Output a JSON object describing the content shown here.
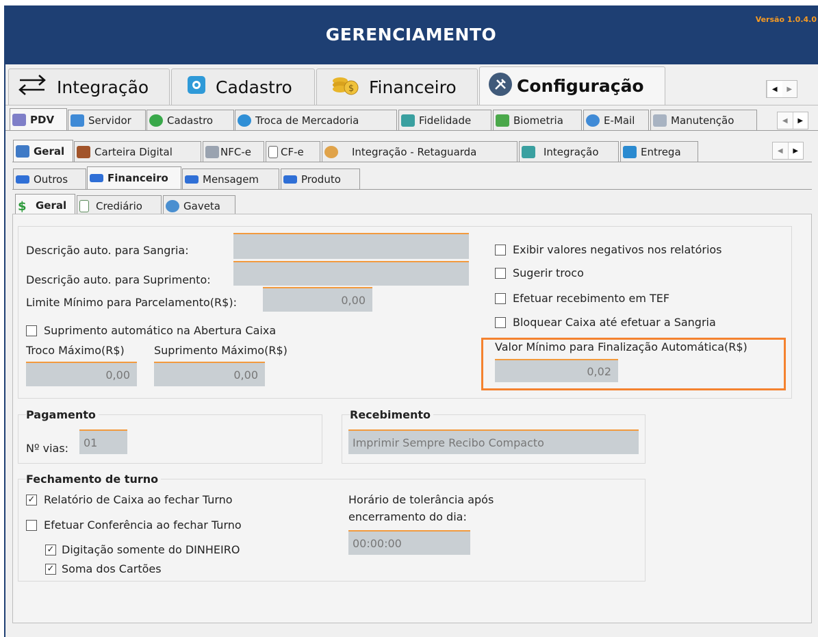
{
  "app": {
    "title": "GERENCIAMENTO",
    "version": "Versão 1.0.4.0"
  },
  "main_tabs": [
    {
      "label": "Integração",
      "icon": "arrows-icon"
    },
    {
      "label": "Cadastro",
      "icon": "cadastro-icon"
    },
    {
      "label": "Financeiro",
      "icon": "coins-icon"
    },
    {
      "label": "Configuração",
      "icon": "tools-icon"
    }
  ],
  "level1_tabs": [
    {
      "label": "PDV",
      "icon": "pdv-icon"
    },
    {
      "label": "Servidor",
      "icon": "server-icon"
    },
    {
      "label": "Cadastro",
      "icon": "plus-icon"
    },
    {
      "label": "Troca de Mercadoria",
      "icon": "exchange-icon"
    },
    {
      "label": "Fidelidade",
      "icon": "refresh-icon"
    },
    {
      "label": "Biometria",
      "icon": "biometry-icon"
    },
    {
      "label": "E-Mail",
      "icon": "at-icon"
    },
    {
      "label": "Manutenção",
      "icon": "wrench-icon"
    }
  ],
  "level2_tabs": [
    {
      "label": "Geral",
      "icon": "general-icon"
    },
    {
      "label": "Carteira Digital",
      "icon": "wallet-icon"
    },
    {
      "label": "NFC-e",
      "icon": "nfce-icon"
    },
    {
      "label": "CF-e",
      "icon": "document-icon"
    },
    {
      "label": "Integração - Retaguarda",
      "icon": "gear-icon"
    },
    {
      "label": "Integração",
      "icon": "refresh-icon"
    },
    {
      "label": "Entrega",
      "icon": "truck-icon"
    }
  ],
  "level3_tabs": [
    {
      "label": "Outros"
    },
    {
      "label": "Financeiro"
    },
    {
      "label": "Mensagem"
    },
    {
      "label": "Produto"
    }
  ],
  "level4_tabs": [
    {
      "label": "Geral",
      "icon": "dollar-icon"
    },
    {
      "label": "Crediário",
      "icon": "spreadsheet-icon"
    },
    {
      "label": "Gaveta",
      "icon": "gear-icon"
    }
  ],
  "form": {
    "sangria_label": "Descrição auto. para Sangria:",
    "sangria_value": "",
    "suprimento_label": "Descrição auto. para Suprimento:",
    "suprimento_value": "",
    "limite_label": "Limite Mínimo para Parcelamento(R$):",
    "limite_value": "0,00",
    "suprimento_auto_label": "Suprimento automático na Abertura Caixa",
    "suprimento_auto_checked": false,
    "troco_max_label": "Troco Máximo(R$)",
    "troco_max_value": "0,00",
    "suprimento_max_label": "Suprimento Máximo(R$)",
    "suprimento_max_value": "0,00",
    "exibir_negativos_label": "Exibir valores negativos nos relatórios",
    "sugerir_troco_label": "Sugerir troco",
    "efetuar_tef_label": "Efetuar recebimento em TEF",
    "bloquear_caixa_label": "Bloquear Caixa até efetuar a Sangria",
    "valor_minimo_label": "Valor Mínimo para Finalização Automática(R$)",
    "valor_minimo_value": "0,02"
  },
  "pagamento": {
    "title": "Pagamento",
    "vias_label": "Nº vias:",
    "vias_value": "01"
  },
  "recebimento": {
    "title": "Recebimento",
    "value": "Imprimir Sempre Recibo Compacto"
  },
  "fechamento": {
    "title": "Fechamento de turno",
    "relatorio_label": "Relatório de Caixa ao fechar Turno",
    "conferencia_label": "Efetuar Conferência ao fechar Turno",
    "digitacao_label": "Digitação somente do DINHEIRO",
    "soma_label": "Soma dos Cartões",
    "horario_label_1": "Horário de tolerância após",
    "horario_label_2": "encerramento do dia:",
    "horario_value": "00:00:00"
  },
  "colors": {
    "title_bar": "#1e3f73",
    "accent": "#f29a3e",
    "version": "#f59a23",
    "highlight": "#f4822f"
  }
}
